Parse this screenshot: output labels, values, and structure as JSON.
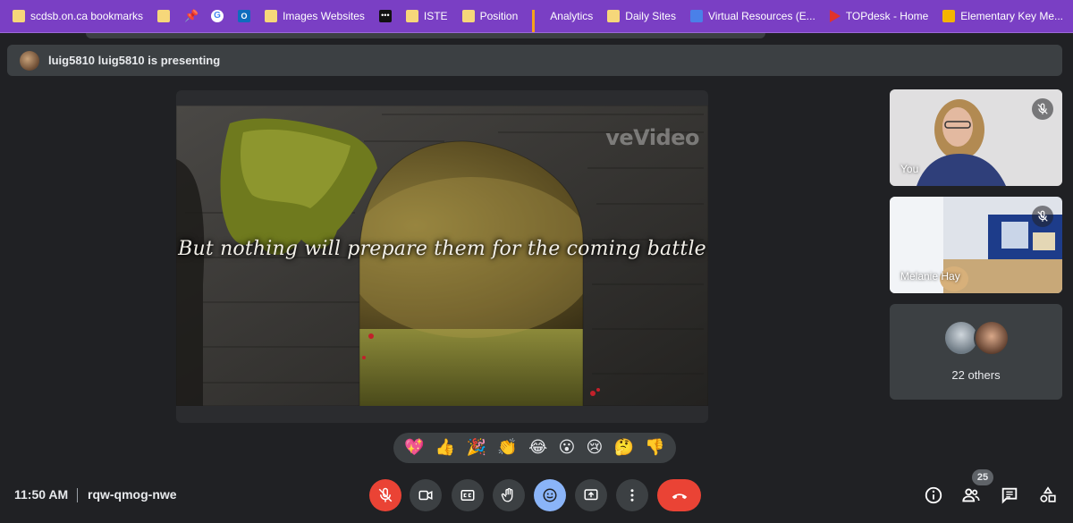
{
  "bookmarks": [
    {
      "label": "scdsb.on.ca bookmarks",
      "icon": "folder-icon"
    },
    {
      "label": "",
      "icon": "folder-icon"
    },
    {
      "label": "",
      "icon": "pin-icon"
    },
    {
      "label": "",
      "icon": "google-icon"
    },
    {
      "label": "",
      "icon": "outlook-icon"
    },
    {
      "label": "Images Websites",
      "icon": "folder-icon"
    },
    {
      "label": "",
      "icon": "dots-app-icon"
    },
    {
      "label": "ISTE",
      "icon": "folder-icon"
    },
    {
      "label": "Position",
      "icon": "folder-icon"
    },
    {
      "label": "Analytics",
      "icon": "analytics-icon"
    },
    {
      "label": "Daily Sites",
      "icon": "folder-icon"
    },
    {
      "label": "Virtual Resources (E...",
      "icon": "docs-icon"
    },
    {
      "label": "TOPdesk - Home",
      "icon": "topdesk-icon"
    },
    {
      "label": "Elementary Key Me...",
      "icon": "slides-icon"
    }
  ],
  "banner": {
    "text": "luig5810 luig5810 is presenting"
  },
  "presentation": {
    "caption": "But nothing will prepare them for the coming battle",
    "watermark": "veVideo"
  },
  "participants": {
    "self_name": "You",
    "second_name": "Melanie Hay",
    "others_label": "22 others"
  },
  "reactions": [
    "💖",
    "👍",
    "🎉",
    "👏",
    "😂",
    "😮",
    "😢",
    "🤔",
    "👎"
  ],
  "footer": {
    "time": "11:50 AM",
    "meeting_code": "rqw-qmog-nwe",
    "participant_count": "25"
  },
  "colors": {
    "bookmark_bar": "#7a3fc4",
    "background": "#202124",
    "danger": "#ea4335",
    "accent": "#8ab4f8"
  }
}
